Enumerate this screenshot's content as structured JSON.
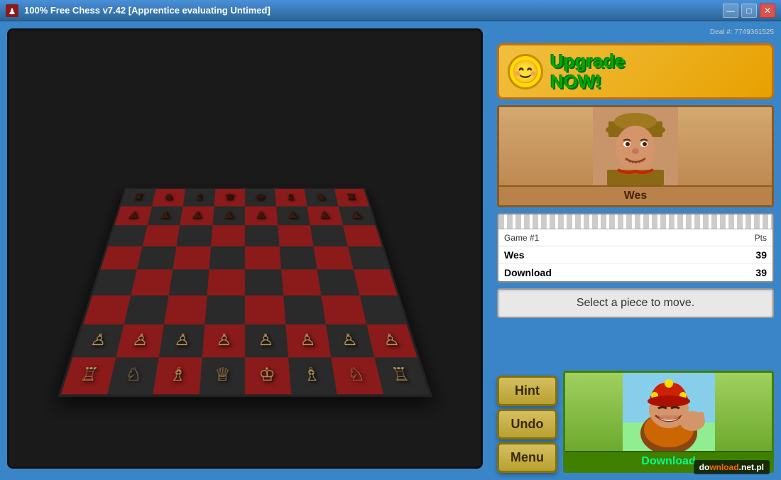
{
  "window": {
    "title": "100% Free Chess v7.42 [Apprentice evaluating Untimed]",
    "min_label": "—",
    "max_label": "□",
    "close_label": "✕"
  },
  "deal": {
    "label": "Deal #: 7749361525"
  },
  "upgrade": {
    "smiley": "😊",
    "line1": "Upgrade",
    "line2": "NOW!"
  },
  "player_top": {
    "name": "Wes"
  },
  "score_table": {
    "game_label": "Game #1",
    "pts_label": "Pts",
    "row1_name": "Wes",
    "row1_pts": "39",
    "row2_name": "Download",
    "row2_pts": "39"
  },
  "message": {
    "text": "Select a piece to move."
  },
  "buttons": {
    "hint": "Hint",
    "undo": "Undo",
    "menu": "Menu"
  },
  "player_bottom": {
    "name": "Download"
  },
  "watermark": {
    "prefix": "do",
    "highlight": "wnload",
    "suffix": ".net.pl"
  },
  "board": {
    "rows": [
      [
        "♜",
        "♞",
        "♝",
        "♛",
        "♚",
        "♝",
        "♞",
        "♜"
      ],
      [
        "♟",
        "♟",
        "♟",
        "♟",
        "♟",
        "♟",
        "♟",
        "♟"
      ],
      [
        "",
        "",
        "",
        "",
        "",
        "",
        "",
        ""
      ],
      [
        "",
        "",
        "",
        "",
        "",
        "",
        "",
        ""
      ],
      [
        "",
        "",
        "",
        "",
        "",
        "",
        "",
        ""
      ],
      [
        "",
        "",
        "",
        "",
        "",
        "",
        "",
        ""
      ],
      [
        "♙",
        "♙",
        "♙",
        "♙",
        "♙",
        "♙",
        "♙",
        "♙"
      ],
      [
        "♖",
        "♘",
        "♗",
        "♕",
        "♔",
        "♗",
        "♘",
        "♖"
      ]
    ]
  }
}
